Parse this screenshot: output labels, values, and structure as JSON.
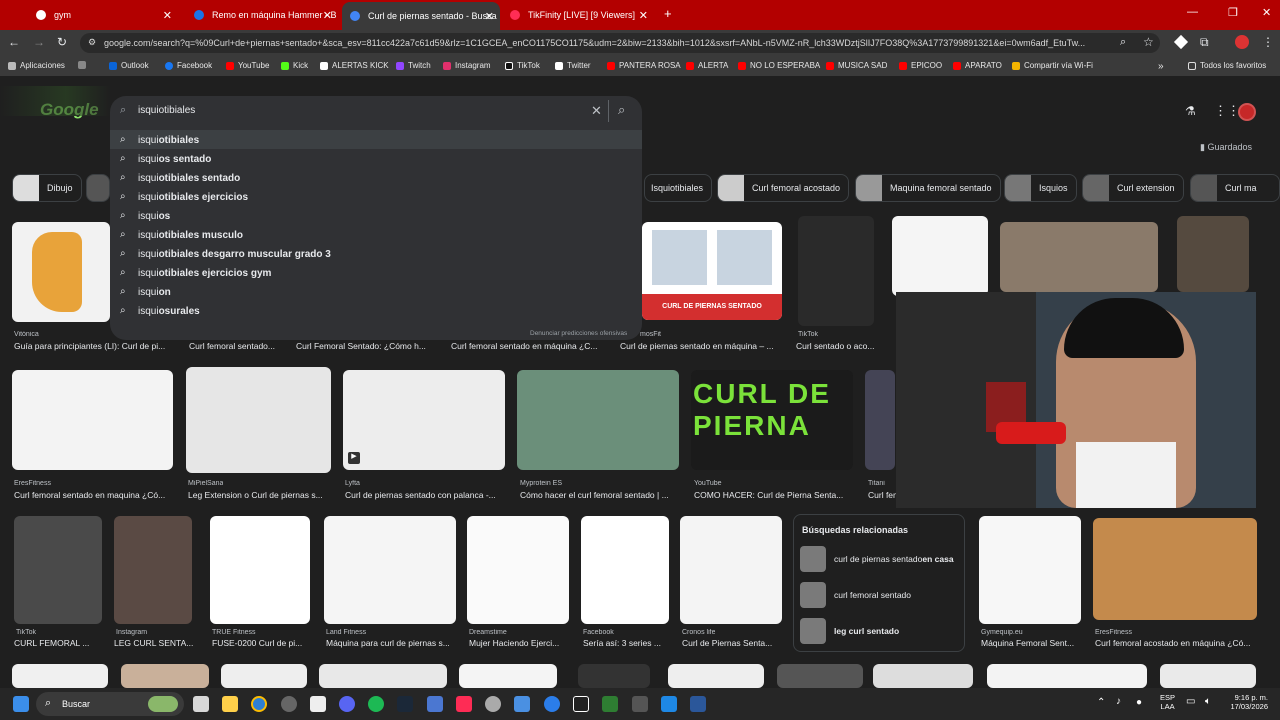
{
  "tabs": [
    {
      "title": "gym",
      "color": "#ffffff"
    },
    {
      "title": "Remo en máquina Hammer - B",
      "color": "#1a73e8"
    },
    {
      "title": "Curl de piernas sentado - Busca",
      "color": "#4285f4"
    },
    {
      "title": "TikFinity [LIVE] [9 Viewers]",
      "color": "#ff2d55"
    }
  ],
  "address_bar": {
    "url": "google.com/search?q=%09Curl+de+piernas+sentado+&sca_esv=811cc422a7c61d59&rlz=1C1GCEA_enCO1175CO1175&udm=2&biw=2133&bih=1012&sxsrf=ANbL-n5VMZ-nR_lch33WDztjSlIJ7FO38Q%3A1773799891321&ei=0wm6adf_EtuTw..."
  },
  "bookmarks": [
    {
      "label": "Aplicaciones",
      "color": "#bbbbbb"
    },
    {
      "label": "Outlook",
      "color": "#0a64d8"
    },
    {
      "label": "Facebook",
      "color": "#1877f2"
    },
    {
      "label": "YouTube",
      "color": "#ff0000"
    },
    {
      "label": "Kick",
      "color": "#53fc18"
    },
    {
      "label": "ALERTAS KICK",
      "color": "#ffffff"
    },
    {
      "label": "Twitch",
      "color": "#9146ff"
    },
    {
      "label": "Instagram",
      "color": "#e1306c"
    },
    {
      "label": "TikTok",
      "color": "#000000"
    },
    {
      "label": "Twitter",
      "color": "#ffffff"
    },
    {
      "label": "PANTERA ROSA",
      "color": "#ff0000"
    },
    {
      "label": "ALERTA",
      "color": "#ff0000"
    },
    {
      "label": "NO LO ESPERABA",
      "color": "#ff0000"
    },
    {
      "label": "MUSICA SAD",
      "color": "#ff0000"
    },
    {
      "label": "EPICOO",
      "color": "#ff0000"
    },
    {
      "label": "APARATO",
      "color": "#ff0000"
    },
    {
      "label": "Compartir vía Wi-Fi",
      "color": "#f4b400"
    }
  ],
  "bookmarks_other": "Todos los favoritos",
  "search": {
    "value": "isquiotibiales",
    "suggestions": [
      {
        "prefix": "isqui",
        "rest": "otibiales"
      },
      {
        "prefix": "isqui",
        "rest": "os sentado"
      },
      {
        "prefix": "isqui",
        "rest": "otibiales sentado"
      },
      {
        "prefix": "isqui",
        "rest": "otibiales ejercicios"
      },
      {
        "prefix": "isqui",
        "rest": "os"
      },
      {
        "prefix": "isqui",
        "rest": "otibiales musculo"
      },
      {
        "prefix": "isqui",
        "rest": "otibiales desgarro muscular grado 3"
      },
      {
        "prefix": "isqui",
        "rest": "otibiales ejercicios gym"
      },
      {
        "prefix": "isqui",
        "rest": "on"
      },
      {
        "prefix": "isqui",
        "rest": "osurales"
      }
    ],
    "report": "Denunciar predicciones ofensivas"
  },
  "saved": "Guardados",
  "chips": [
    "Dibujo",
    "Isquiotibiales",
    "Curl femoral acostado",
    "Maquina femoral sentado",
    "Isquios",
    "Curl extension",
    "Curl ma"
  ],
  "row1": [
    {
      "src": "Vitónica",
      "cap": "Guía para principiantes (LI): Curl de pi..."
    },
    {
      "src": "",
      "cap": "Curl femoral sentado..."
    },
    {
      "src": "",
      "cap": "Curl Femoral Sentado: ¿Cómo h..."
    },
    {
      "src": "",
      "cap": "Curl femoral sentado en máquina ¿C..."
    },
    {
      "src": "mosFit",
      "cap": "Curl de piernas sentado en máquina – ..."
    },
    {
      "src": "TikTok",
      "cap": "Curl sentado o aco..."
    }
  ],
  "row1_img_text": "CURL DE PIERNAS SENTADO",
  "row2": [
    {
      "src": "EresFitness",
      "cap": "Curl femoral sentado en maquina ¿Có..."
    },
    {
      "src": "MiPielSana",
      "cap": "Leg Extension o Curl de piernas s..."
    },
    {
      "src": "Lyfta",
      "cap": "Curl de piernas sentado con palanca -..."
    },
    {
      "src": "Myprotein ES",
      "cap": "Cómo hacer el curl femoral sentado | ..."
    },
    {
      "src": "YouTube",
      "cap": "COMO HACER: Curl de Pierna Senta..."
    },
    {
      "src": "Titani",
      "cap": "Curl fem"
    }
  ],
  "row2_banner": "CURL DE PIERNA",
  "row3": [
    {
      "src": "TikTok",
      "cap": "CURL FEMORAL ..."
    },
    {
      "src": "Instagram",
      "cap": "LEG CURL SENTA..."
    },
    {
      "src": "TRUE Fitness",
      "cap": "FUSE-0200 Curl de pi..."
    },
    {
      "src": "Land Fitness",
      "cap": "Máquina para curl de piernas s..."
    },
    {
      "src": "Dreamstime",
      "cap": "Mujer Haciendo Ejerci..."
    },
    {
      "src": "Facebook",
      "cap": "Sería así: 3 series ..."
    },
    {
      "src": "Cronos life",
      "cap": "Curl de Piernas Senta..."
    },
    {
      "src": "Gymequip.eu",
      "cap": "Máquina Femoral Sent..."
    },
    {
      "src": "EresFitness",
      "cap": "Curl femoral acostado en máquina ¿Có..."
    }
  ],
  "related": {
    "title": "Búsquedas relacionadas",
    "items": [
      {
        "plain": "curl de piernas sentado ",
        "bold": "en casa"
      },
      {
        "plain": "curl femoral sentado",
        "bold": ""
      },
      {
        "plain": "",
        "bold": "leg curl sentado"
      }
    ]
  },
  "taskbar": {
    "search_label": "Buscar",
    "lang": "ESP",
    "lang2": "LAA",
    "time": "9:16 p. m.",
    "date": "17/03/2026"
  },
  "colors": {
    "tab_bar": "#b30000",
    "page_bg": "#1f1f1f",
    "accent": "#8de36a"
  }
}
